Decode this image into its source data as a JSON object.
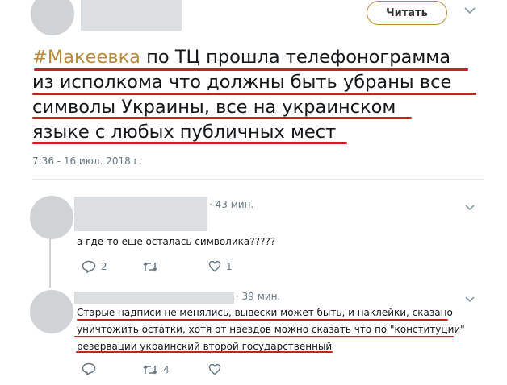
{
  "main_tweet": {
    "follow_label": "Читать",
    "hashtag": "#Макеевка",
    "line1_rest": " по ТЦ прошла телефонограмма",
    "line2": "из исполкома что должны быть убраны все",
    "line3": "символы Украины, все на украинском",
    "line4": "языке с любых публичных мест",
    "timestamp": "7:36 - 16 июл. 2018 г."
  },
  "replies": [
    {
      "time": "· 43 мин.",
      "text": "а где-то еще осталась символика?????",
      "reply_count": "2",
      "retweet_count": "",
      "like_count": "1"
    },
    {
      "time": "· 39 мин.",
      "lines": [
        "Старые надписи не менялись, вывески может быть, и наклейки, сказано",
        "уничтожить остатки, хотя от наездов можно сказать что по \"конституции\"",
        "резервации украинский второй государственный"
      ],
      "reply_count": "",
      "retweet_count": "4",
      "like_count": ""
    }
  ],
  "icons": [
    "chevron-down-icon",
    "reply-icon",
    "retweet-icon",
    "like-icon"
  ],
  "colors": {
    "hashtag": "#b8893a",
    "underline": "#cc1f1f",
    "muted": "#657786"
  }
}
